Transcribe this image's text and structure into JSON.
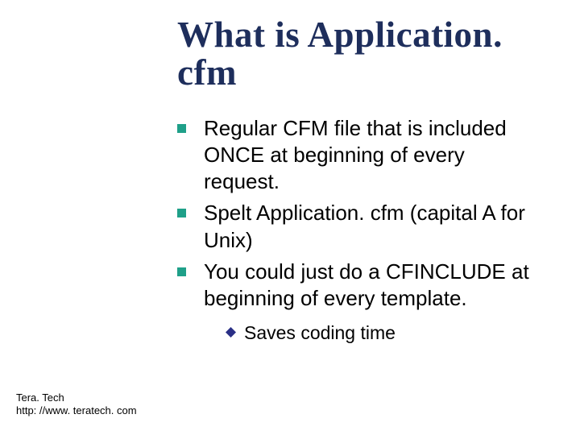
{
  "title": "What is Application. cfm",
  "bullets": [
    "Regular CFM file that is included ONCE at beginning of every request.",
    "Spelt Application. cfm (capital A for Unix)",
    "You could just do a CFINCLUDE at beginning of every template."
  ],
  "sub_bullets": [
    "Saves coding time"
  ],
  "footer": {
    "org": "Tera. Tech",
    "url": "http: //www. teratech. com"
  },
  "colors": {
    "title": "#1e2e5c",
    "square_bullet": "#1fa089",
    "diamond_bullet": "#2a2f86"
  }
}
